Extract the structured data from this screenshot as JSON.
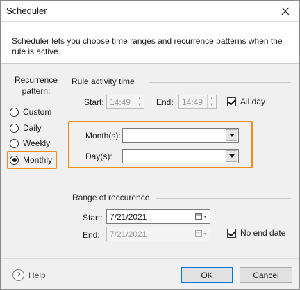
{
  "window": {
    "title": "Scheduler"
  },
  "description": "Scheduler lets you choose time ranges and recurrence patterns when the rule is active.",
  "recurrence": {
    "label": "Recurrence pattern:",
    "options": [
      {
        "label": "Custom",
        "checked": false
      },
      {
        "label": "Daily",
        "checked": false
      },
      {
        "label": "Weekly",
        "checked": false
      },
      {
        "label": "Monthly",
        "checked": true
      }
    ]
  },
  "rule_activity": {
    "title": "Rule activity time",
    "start_label": "Start:",
    "start_value": "14:49",
    "end_label": "End:",
    "end_value": "14:49",
    "all_day_label": "All day",
    "all_day_checked": true
  },
  "monthly": {
    "months_label": "Month(s):",
    "months_value": "",
    "days_label": "Day(s):",
    "days_value": ""
  },
  "range": {
    "title": "Range of reccurence",
    "start_label": "Start:",
    "start_value": "7/21/2021",
    "end_label": "End:",
    "end_value": "7/21/2021",
    "no_end_label": "No end date",
    "no_end_checked": true
  },
  "footer": {
    "help_label": "Help",
    "ok_label": "OK",
    "cancel_label": "Cancel"
  },
  "colors": {
    "highlight": "#f28c1c",
    "accent": "#0078d7"
  }
}
